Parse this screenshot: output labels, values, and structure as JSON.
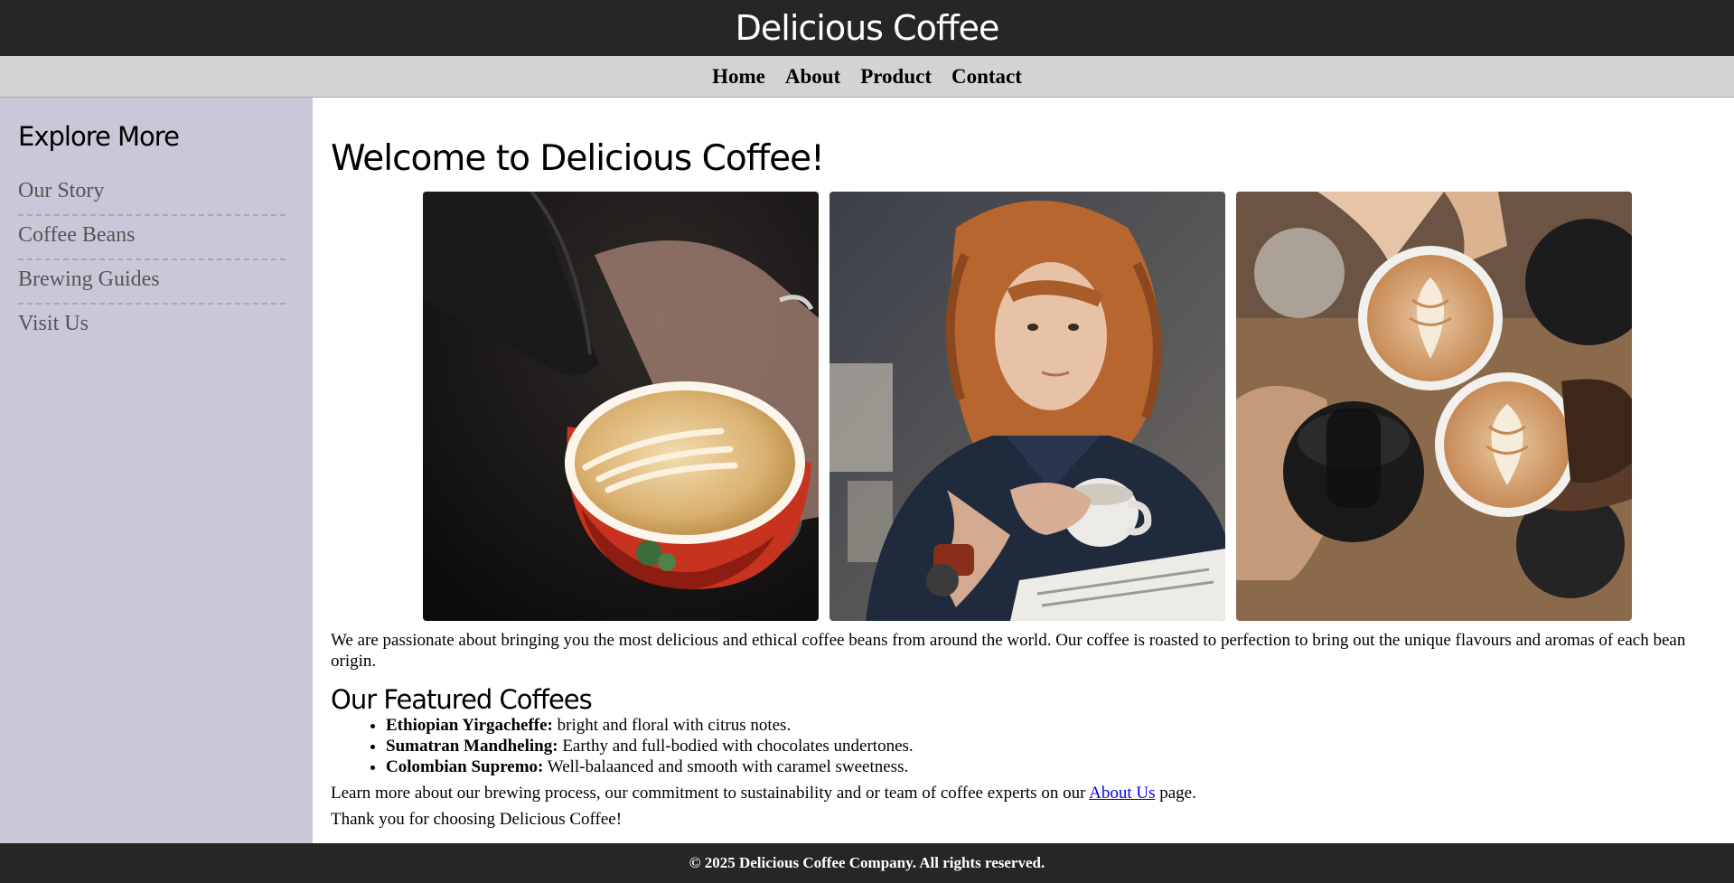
{
  "header": {
    "title": "Delicious Coffee"
  },
  "nav": {
    "items": [
      "Home",
      "About",
      "Product",
      "Contact"
    ]
  },
  "sidebar": {
    "title": "Explore More",
    "items": [
      "Our Story",
      "Coffee Beans",
      "Brewing Guides",
      "Visit Us"
    ]
  },
  "main": {
    "heading": "Welcome to Delicious Coffee!",
    "images": [
      {
        "name": "latte-art-pour-photo"
      },
      {
        "name": "man-drinking-coffee-photo"
      },
      {
        "name": "coffee-cheers-photo"
      }
    ],
    "intro": "We are passionate about bringing you the most delicious and ethical coffee beans from around the world. Our coffee is roasted to perfection to bring out the unique flavours and aromas of each bean origin.",
    "featured_title": "Our Featured Coffees",
    "coffees": [
      {
        "name": "Ethiopian Yirgacheffe:",
        "desc": " bright and floral with citrus notes."
      },
      {
        "name": "Sumatran Mandheling:",
        "desc": " Earthy and full-bodied with chocolates undertones."
      },
      {
        "name": "Colombian Supremo:",
        "desc": " Well-balaanced and smooth with caramel sweetness."
      }
    ],
    "learn_more_before": "Learn more about our brewing process, our commitment to sustainability and or team of coffee experts on our ",
    "learn_more_link": "About Us",
    "learn_more_after": " page.",
    "thanks": "Thank you for choosing Delicious Coffee!"
  },
  "footer": {
    "text": "© 2025 Delicious Coffee Company. All rights reserved."
  },
  "colors": {
    "header_bg": "#262626",
    "nav_bg": "#d3d3d3",
    "sidebar_bg": "#c8c8d8",
    "link": "#0000ee"
  }
}
